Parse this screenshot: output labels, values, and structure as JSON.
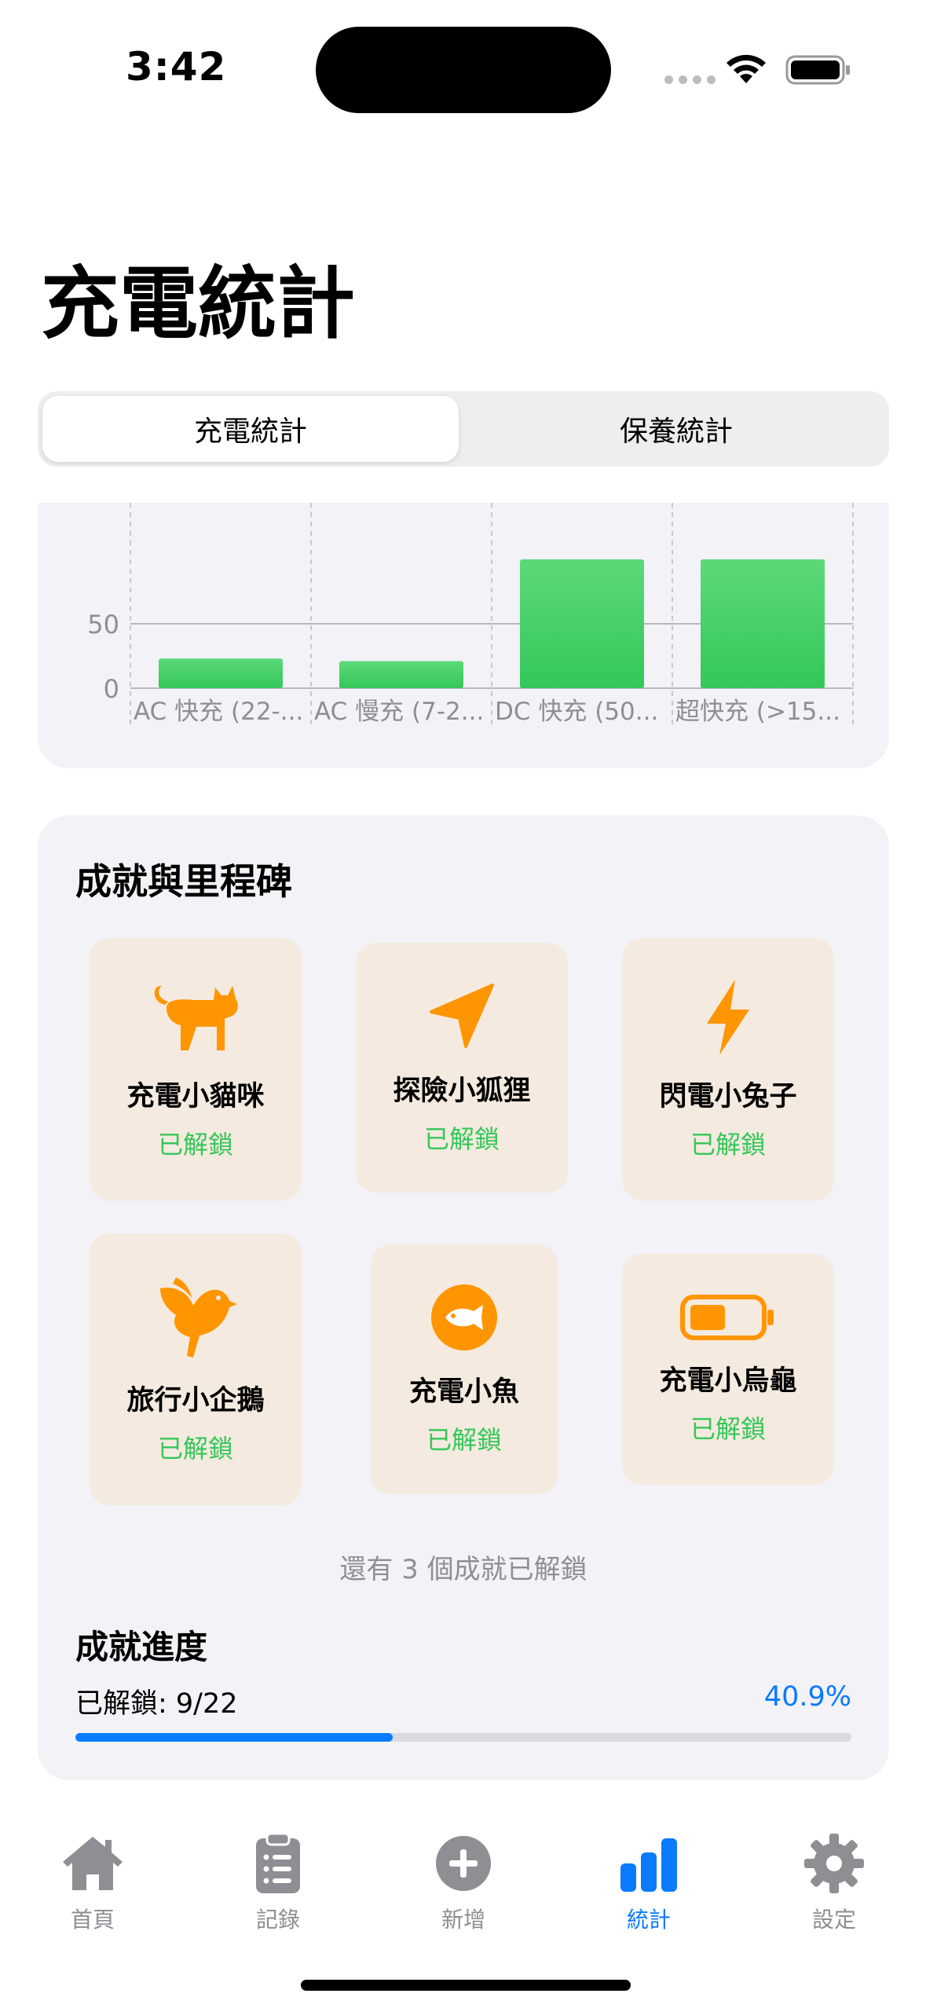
{
  "status_bar": {
    "time": "3:42"
  },
  "page_title": "充電統計",
  "segments": [
    {
      "label": "充電統計",
      "selected": true
    },
    {
      "label": "保養統計",
      "selected": false
    }
  ],
  "chart_data": {
    "type": "bar",
    "categories": [
      "AC 快充 (22-...",
      "AC 慢充 (7-2...",
      "DC 快充 (50...",
      "超快充 (>15..."
    ],
    "values": [
      23,
      21,
      100,
      100
    ],
    "yticks": [
      0,
      50
    ],
    "ylim": [
      0,
      88
    ],
    "color": "#34c759"
  },
  "achievements": {
    "title": "成就與里程碑",
    "items": [
      {
        "name": "充電小貓咪",
        "status": "已解鎖",
        "icon": "cat-icon"
      },
      {
        "name": "探險小狐狸",
        "status": "已解鎖",
        "icon": "location-arrow-icon"
      },
      {
        "name": "閃電小兔子",
        "status": "已解鎖",
        "icon": "bolt-icon"
      },
      {
        "name": "旅行小企鵝",
        "status": "已解鎖",
        "icon": "bird-icon"
      },
      {
        "name": "充電小魚",
        "status": "已解鎖",
        "icon": "fish-icon"
      },
      {
        "name": "充電小烏龜",
        "status": "已解鎖",
        "icon": "battery-icon"
      }
    ],
    "note": "還有 3 個成就已解鎖",
    "accent": "#ff9500"
  },
  "progress": {
    "title": "成就進度",
    "label": "已解鎖: 9/22",
    "percent_text": "40.9%",
    "fraction": 0.409
  },
  "tabbar": [
    {
      "label": "首頁",
      "icon": "house-icon",
      "active": false
    },
    {
      "label": "記錄",
      "icon": "clipboard-list-icon",
      "active": false
    },
    {
      "label": "新增",
      "icon": "plus-circle-icon",
      "active": false
    },
    {
      "label": "統計",
      "icon": "bar-chart-icon",
      "active": true
    },
    {
      "label": "設定",
      "icon": "gear-icon",
      "active": false
    }
  ]
}
